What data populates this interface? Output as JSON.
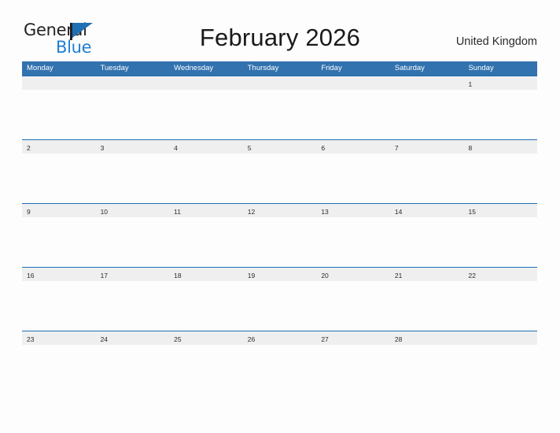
{
  "brand": {
    "name_part1": "General",
    "name_part2": "Blue",
    "flag_icon": "blue-triangle-flag-icon",
    "primary_color": "#1f6fb4",
    "accent_color": "#1f7fd0"
  },
  "header": {
    "title": "February 2026",
    "locale": "United Kingdom"
  },
  "colors": {
    "header_row_blue": "#3272af",
    "grid_line_blue": "#1f6fb4",
    "day_band_gray": "#efefef",
    "page_background": "#fdfdfd",
    "weekday_text": "#ffffff",
    "day_number_text": "#2b2b2b"
  },
  "calendar": {
    "month": "February",
    "year": "2026",
    "week_start": "Monday",
    "weekdays": [
      "Monday",
      "Tuesday",
      "Wednesday",
      "Thursday",
      "Friday",
      "Saturday",
      "Sunday"
    ],
    "weeks": [
      {
        "days": [
          {
            "num": ""
          },
          {
            "num": ""
          },
          {
            "num": ""
          },
          {
            "num": ""
          },
          {
            "num": ""
          },
          {
            "num": ""
          },
          {
            "num": "1"
          }
        ]
      },
      {
        "days": [
          {
            "num": "2"
          },
          {
            "num": "3"
          },
          {
            "num": "4"
          },
          {
            "num": "5"
          },
          {
            "num": "6"
          },
          {
            "num": "7"
          },
          {
            "num": "8"
          }
        ]
      },
      {
        "days": [
          {
            "num": "9"
          },
          {
            "num": "10"
          },
          {
            "num": "11"
          },
          {
            "num": "12"
          },
          {
            "num": "13"
          },
          {
            "num": "14"
          },
          {
            "num": "15"
          }
        ]
      },
      {
        "days": [
          {
            "num": "16"
          },
          {
            "num": "17"
          },
          {
            "num": "18"
          },
          {
            "num": "19"
          },
          {
            "num": "20"
          },
          {
            "num": "21"
          },
          {
            "num": "22"
          }
        ]
      },
      {
        "days": [
          {
            "num": "23"
          },
          {
            "num": "24"
          },
          {
            "num": "25"
          },
          {
            "num": "26"
          },
          {
            "num": "27"
          },
          {
            "num": "28"
          },
          {
            "num": ""
          }
        ]
      }
    ]
  }
}
